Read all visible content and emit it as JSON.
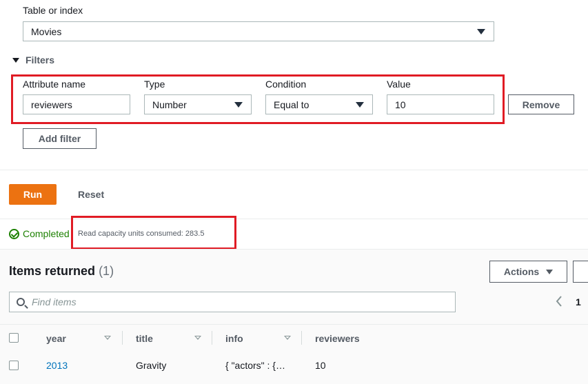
{
  "form": {
    "table_label": "Table or index",
    "table_value": "Movies",
    "filters_label": "Filters",
    "filter": {
      "attr_label": "Attribute name",
      "attr_value": "reviewers",
      "type_label": "Type",
      "type_value": "Number",
      "condition_label": "Condition",
      "condition_value": "Equal to",
      "value_label": "Value",
      "value_value": "10",
      "remove_label": "Remove"
    },
    "add_filter_label": "Add filter"
  },
  "actions": {
    "run_label": "Run",
    "reset_label": "Reset"
  },
  "status": {
    "text": "Completed",
    "rcu_text": "Read capacity units consumed: 283.5"
  },
  "results": {
    "title": "Items returned",
    "count": "(1)",
    "actions_label": "Actions",
    "search_placeholder": "Find items",
    "page": "1",
    "columns": [
      "year",
      "title",
      "info",
      "reviewers"
    ],
    "rows": [
      {
        "year": "2013",
        "title": "Gravity",
        "info": "{ \"actors\" : {…",
        "reviewers": "10"
      }
    ]
  },
  "colors": {
    "primary": "#ec7211",
    "highlight": "#e01b24",
    "success": "#1d8102",
    "link": "#0073bb"
  }
}
